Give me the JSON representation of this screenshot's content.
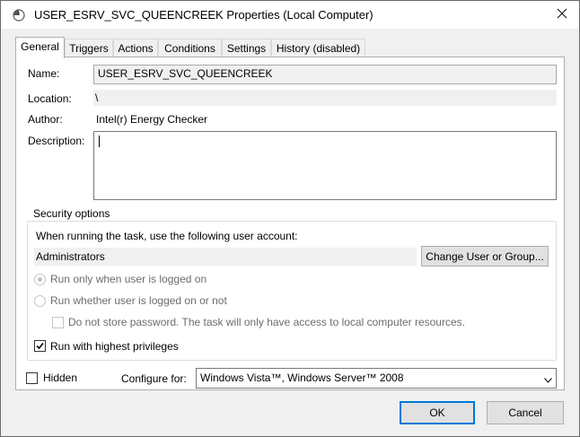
{
  "window": {
    "title": "USER_ESRV_SVC_QUEENCREEK Properties (Local Computer)"
  },
  "tabs": [
    {
      "label": "General"
    },
    {
      "label": "Triggers"
    },
    {
      "label": "Actions"
    },
    {
      "label": "Conditions"
    },
    {
      "label": "Settings"
    },
    {
      "label": "History (disabled)"
    }
  ],
  "general": {
    "name_label": "Name:",
    "name_value": "USER_ESRV_SVC_QUEENCREEK",
    "location_label": "Location:",
    "location_value": "\\",
    "author_label": "Author:",
    "author_value": "Intel(r) Energy Checker",
    "description_label": "Description:",
    "description_value": ""
  },
  "security": {
    "group_title": "Security options",
    "account_prompt": "When running the task, use the following user account:",
    "account_value": "Administrators",
    "change_button": "Change User or Group...",
    "radio_logged_on": "Run only when user is logged on",
    "radio_whether": "Run whether user is logged on or not",
    "do_not_store": "Do not store password.  The task will only have access to local computer resources.",
    "highest_privileges": "Run with highest privileges"
  },
  "bottom": {
    "hidden_label": "Hidden",
    "configure_label": "Configure for:",
    "configure_value": "Windows Vista™, Windows Server™ 2008"
  },
  "buttons": {
    "ok": "OK",
    "cancel": "Cancel"
  },
  "state": {
    "active_tab": "General",
    "run_only_logged_on": true,
    "run_whether": false,
    "do_not_store_checked": false,
    "highest_privileges_checked": true,
    "hidden_checked": false
  },
  "colors": {
    "accent": "#0078d7",
    "panel": "#ffffff",
    "dialog": "#f0f0f0"
  }
}
